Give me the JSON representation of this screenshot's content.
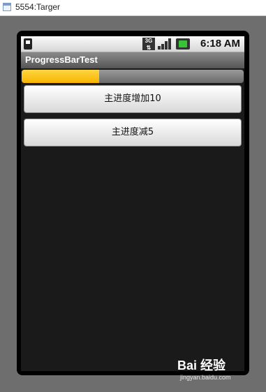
{
  "window": {
    "title": "5554:Targer"
  },
  "statusbar": {
    "network": "3G",
    "time": "6:18 AM"
  },
  "app": {
    "title": "ProgressBarTest"
  },
  "progress": {
    "value_fraction": 0.35,
    "color": "#f7b400"
  },
  "buttons": {
    "increase_label": "主进度增加10",
    "decrease_label": "主进度减5"
  },
  "watermark": {
    "logo": "Bai 经验",
    "url": "jingyan.baidu.com"
  }
}
